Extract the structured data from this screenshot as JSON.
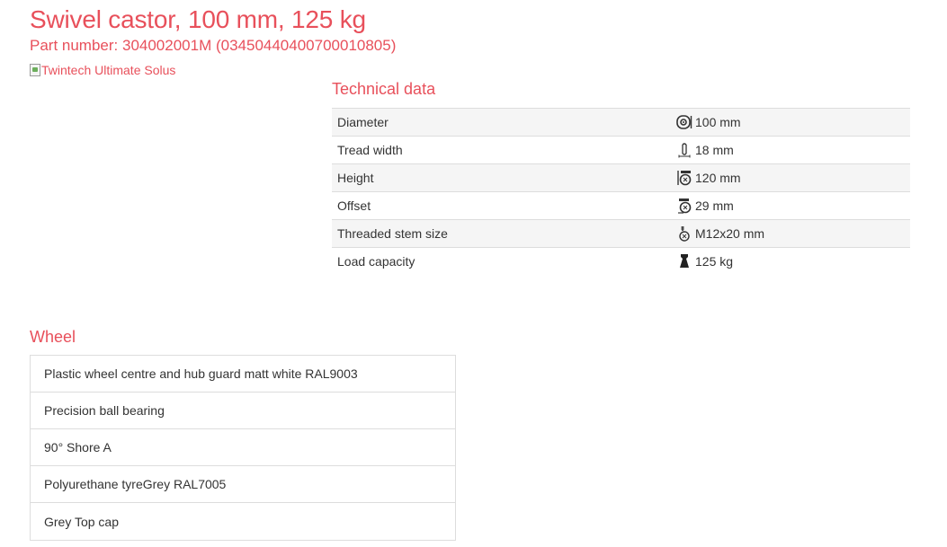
{
  "product": {
    "title": "Swivel castor, 100 mm, 125 kg",
    "part_number": "Part number: 304002001M (03450440400700010805)",
    "image_alt": "Twintech Ultimate Solus"
  },
  "technical_data": {
    "heading": "Technical data",
    "rows": [
      {
        "label": "Diameter",
        "value": "100 mm",
        "icon": "diameter-icon"
      },
      {
        "label": "Tread width",
        "value": "18 mm",
        "icon": "tread-width-icon"
      },
      {
        "label": "Height",
        "value": "120 mm",
        "icon": "height-icon"
      },
      {
        "label": "Offset",
        "value": "29 mm",
        "icon": "offset-icon"
      },
      {
        "label": "Threaded stem size",
        "value": "M12x20 mm",
        "icon": "threaded-stem-icon"
      },
      {
        "label": "Load capacity",
        "value": "125 kg",
        "icon": "load-capacity-icon"
      }
    ]
  },
  "wheel": {
    "heading": "Wheel",
    "items": [
      "Plastic wheel centre and hub guard matt white RAL9003",
      "Precision ball bearing",
      "90° Shore A",
      "Polyurethane tyreGrey RAL7005",
      "Grey Top cap"
    ]
  },
  "colors": {
    "accent": "#e8505b",
    "text": "#333333",
    "row_alt": "#f5f5f5",
    "border": "#dddddd"
  }
}
